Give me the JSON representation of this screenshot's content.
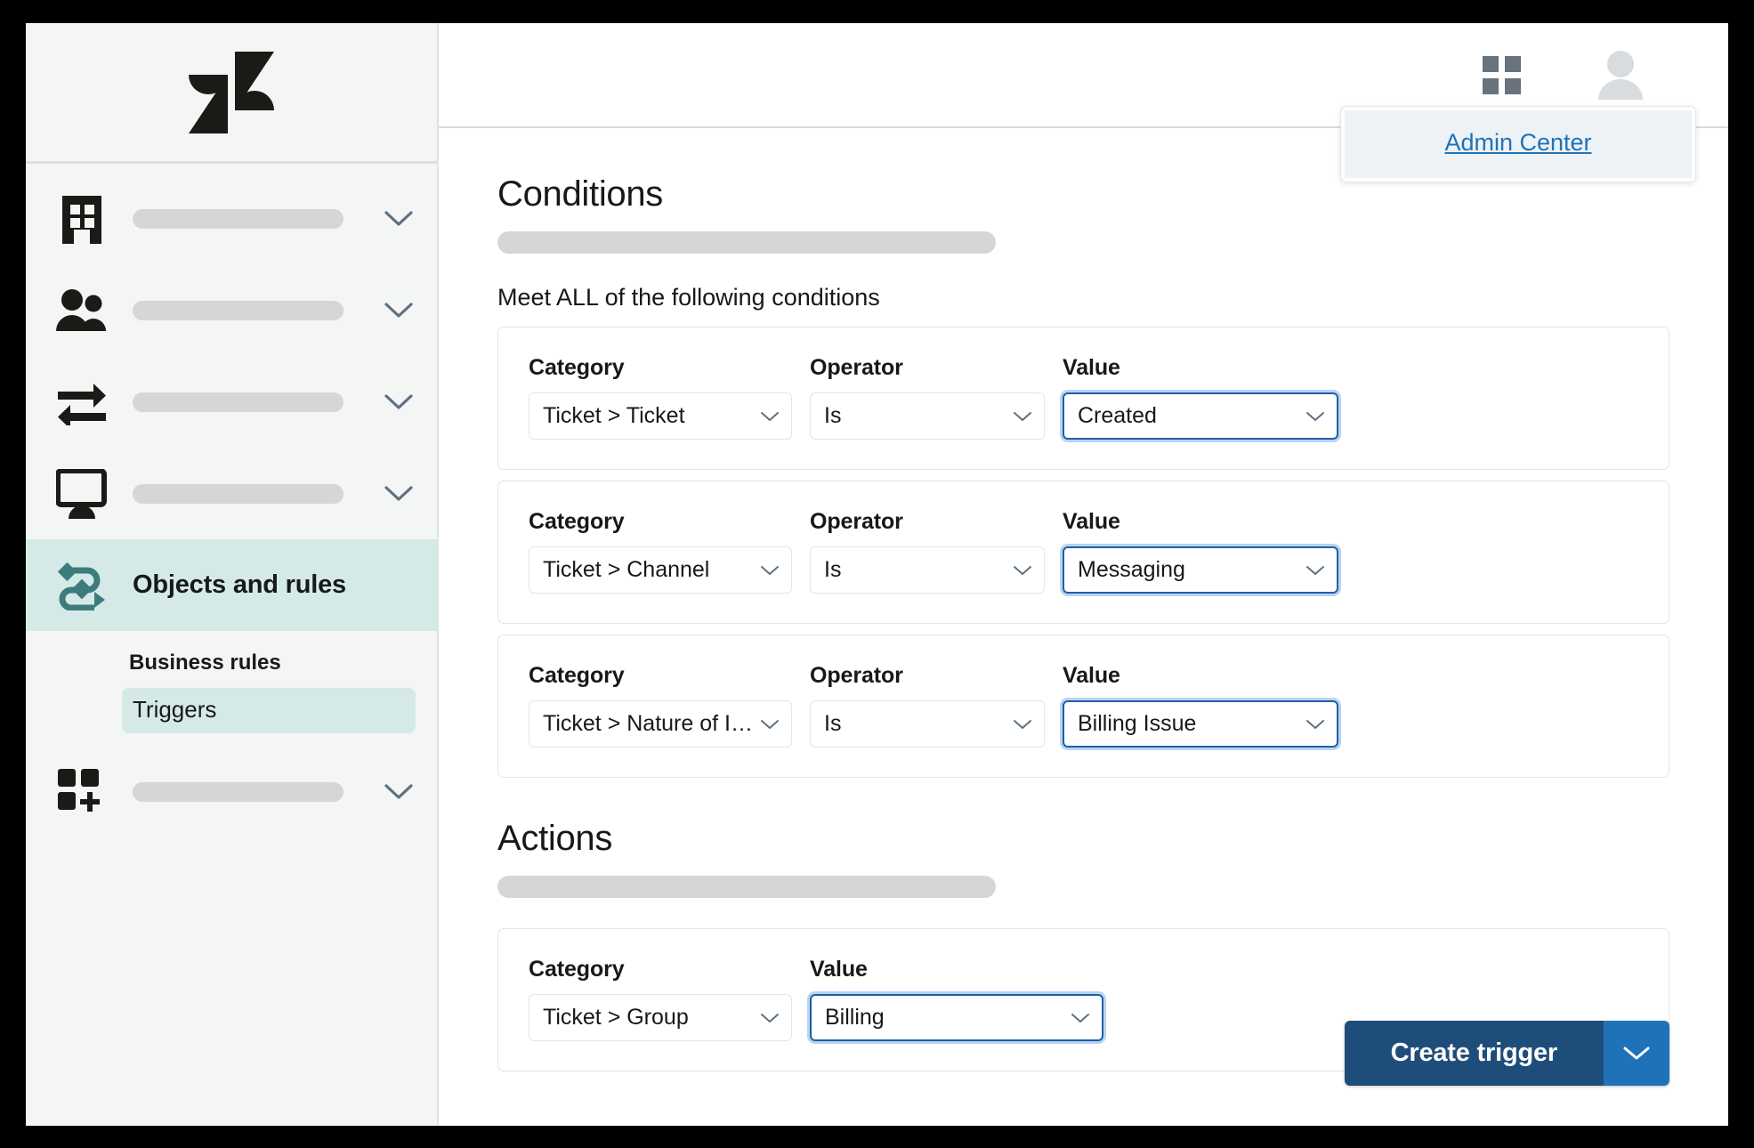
{
  "window": {
    "border_color": "#000000"
  },
  "sidebar": {
    "logo_name": "zendesk-logo",
    "items": [
      {
        "icon": "building-icon",
        "label": "",
        "has_placeholder": true,
        "has_chevron": true
      },
      {
        "icon": "people-icon",
        "label": "",
        "has_placeholder": true,
        "has_chevron": true
      },
      {
        "icon": "transfer-arrows-icon",
        "label": "",
        "has_placeholder": true,
        "has_chevron": true
      },
      {
        "icon": "monitor-icon",
        "label": "",
        "has_placeholder": true,
        "has_chevron": true
      },
      {
        "icon": "objects-rules-icon",
        "label": "Objects and rules",
        "has_placeholder": false,
        "has_chevron": false,
        "active": true
      },
      {
        "icon": "apps-add-icon",
        "label": "",
        "has_placeholder": true,
        "has_chevron": true
      }
    ],
    "sub_section": {
      "heading": "Business rules",
      "selected_item": "Triggers"
    },
    "active_bg": "#d5eae7",
    "icon_accent": "#3d7c7c"
  },
  "topbar": {
    "grid_icon": "products-grid-icon",
    "avatar_icon": "user-avatar-icon",
    "grid_color": "#68737d",
    "avatar_color": "#d8dcde",
    "dropdown": {
      "link_label": "Admin Center",
      "link_color": "#1f73b7",
      "panel_bg": "#edf2f7"
    }
  },
  "conditions": {
    "title": "Conditions",
    "meet_all_label": "Meet ALL of the following conditions",
    "labels": {
      "category": "Category",
      "operator": "Operator",
      "value": "Value"
    },
    "rows": [
      {
        "category": "Ticket > Ticket",
        "operator": "Is",
        "value": "Created",
        "value_focused": true
      },
      {
        "category": "Ticket > Channel",
        "operator": "Is",
        "value": "Messaging",
        "value_focused": true
      },
      {
        "category": "Ticket > Nature of Issue",
        "operator": "Is",
        "value": "Billing Issue",
        "value_focused": true
      }
    ]
  },
  "actions": {
    "title": "Actions",
    "labels": {
      "category": "Category",
      "value": "Value"
    },
    "rows": [
      {
        "category": "Ticket > Group",
        "value": "Billing",
        "value_focused": true
      }
    ]
  },
  "footer": {
    "create_trigger_label": "Create trigger",
    "caret_icon": "chevron-down-icon",
    "primary_color": "#1f4d7a",
    "caret_color": "#1f72b8"
  }
}
